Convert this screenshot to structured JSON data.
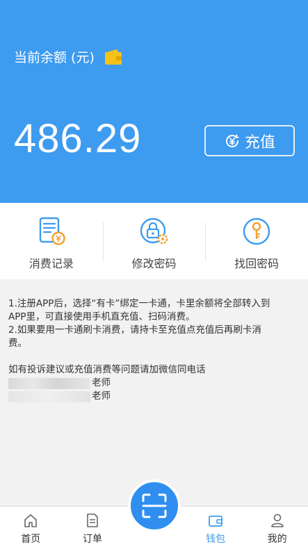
{
  "wallet": {
    "balance_label": "当前余额 (元)",
    "balance": "486.29",
    "recharge_label": "充值"
  },
  "actions": [
    {
      "label": "消费记录",
      "icon": "bill-icon"
    },
    {
      "label": "修改密码",
      "icon": "lock-gear-icon"
    },
    {
      "label": "找回密码",
      "icon": "key-icon"
    }
  ],
  "notice": {
    "line1": "1.注册APP后，选择“有卡”绑定一卡通，卡里余额将全部转入到",
    "line2": "APP里，可直接使用手机直充值、扫码消费。",
    "line3": "2.如果要用一卡通刷卡消费，请持卡至充值点充值后再刷卡消",
    "line4": "费。",
    "contact_intro": "如有投诉建议或充值消费等问题请加微信同电话",
    "contact1_suffix": "老师",
    "contact2_suffix": "老师"
  },
  "tabbar": [
    {
      "label": "首页",
      "icon": "home-icon"
    },
    {
      "label": "订单",
      "icon": "order-icon"
    },
    {
      "label": "",
      "icon": "scan-icon"
    },
    {
      "label": "钱包",
      "icon": "wallet-icon",
      "active": true
    },
    {
      "label": "我的",
      "icon": "user-icon"
    }
  ],
  "colors": {
    "primary": "#3d9bf0",
    "accent_yellow": "#f5b820",
    "accent_orange": "#f0a030"
  }
}
